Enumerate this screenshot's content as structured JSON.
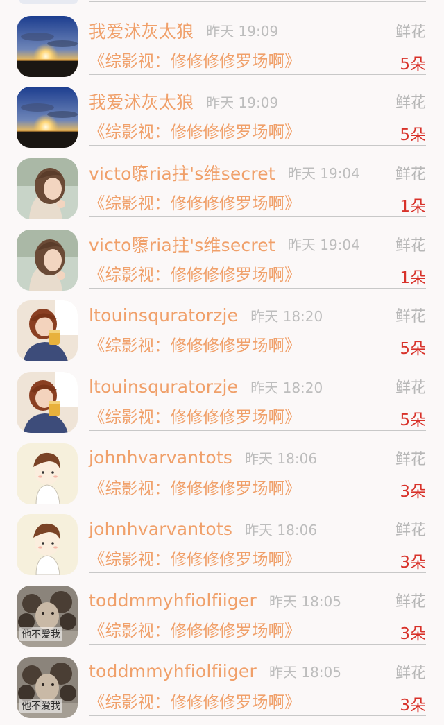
{
  "gift_records": [
    {
      "user": "我爱沭灰太狼",
      "time": "昨天 19:09",
      "gift_type": "鲜花",
      "book": "《综影视：修修修修罗场啊》",
      "count": "5朵",
      "avatar": "sunset-avatar"
    },
    {
      "user": "我爱沭灰太狼",
      "time": "昨天 19:09",
      "gift_type": "鲜花",
      "book": "《综影视：修修修修罗场啊》",
      "count": "5朵",
      "avatar": "sunset-avatar"
    },
    {
      "user": "victo隳ria拄's维secret",
      "time": "昨天 19:04",
      "gift_type": "鲜花",
      "book": "《综影视：修修修修罗场啊》",
      "count": "1朵",
      "avatar": "girl-portrait-avatar"
    },
    {
      "user": "victo隳ria拄's维secret",
      "time": "昨天 19:04",
      "gift_type": "鲜花",
      "book": "《综影视：修修修修罗场啊》",
      "count": "1朵",
      "avatar": "girl-portrait-avatar"
    },
    {
      "user": "ltouinsquratorzje",
      "time": "昨天 18:20",
      "gift_type": "鲜花",
      "book": "《综影视：修修修修罗场啊》",
      "count": "5朵",
      "avatar": "girl-drink-avatar"
    },
    {
      "user": "ltouinsquratorzje",
      "time": "昨天 18:20",
      "gift_type": "鲜花",
      "book": "《综影视：修修修修罗场啊》",
      "count": "5朵",
      "avatar": "girl-drink-avatar"
    },
    {
      "user": "johnhvarvantots",
      "time": "昨天 18:06",
      "gift_type": "鲜花",
      "book": "《综影视：修修修修罗场啊》",
      "count": "3朵",
      "avatar": "cartoon-boy-avatar"
    },
    {
      "user": "johnhvarvantots",
      "time": "昨天 18:06",
      "gift_type": "鲜花",
      "book": "《综影视：修修修修罗场啊》",
      "count": "3朵",
      "avatar": "cartoon-boy-avatar"
    },
    {
      "user": "toddmmyhfiolfiiger",
      "time": "昨天 18:05",
      "gift_type": "鲜花",
      "book": "《综影视：修修修修罗场啊》",
      "count": "3朵",
      "avatar": "curly-hair-avatar",
      "avatar_caption": "他不爱我"
    },
    {
      "user": "toddmmyhfiolfiiger",
      "time": "昨天 18:05",
      "gift_type": "鲜花",
      "book": "《综影视：修修修修罗场啊》",
      "count": "3朵",
      "avatar": "curly-hair-avatar",
      "avatar_caption": "他不爱我"
    }
  ]
}
